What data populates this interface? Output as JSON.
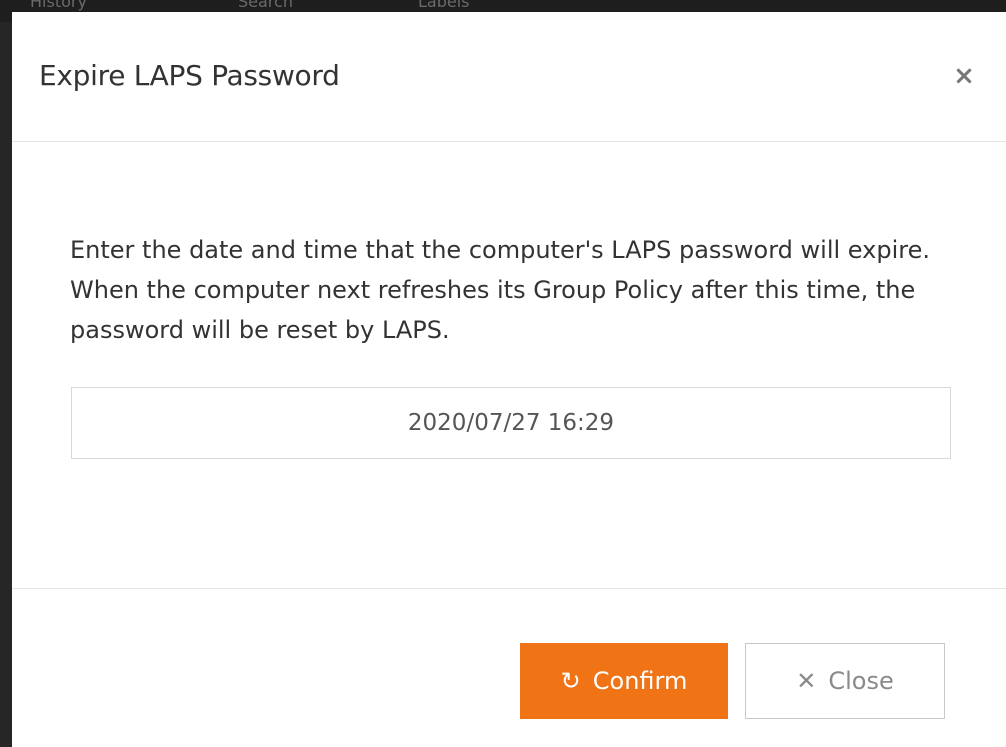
{
  "background": {
    "tabs": [
      "History",
      "Search",
      "Labels"
    ]
  },
  "dialog": {
    "title": "Expire LAPS Password",
    "close_icon": "×",
    "description": "Enter the date and time that the computer's LAPS password will expire. When the computer next refreshes its Group Policy after this time, the password will be reset by LAPS.",
    "expiry_value": "2020/07/27 16:29",
    "confirm_label": "Confirm",
    "confirm_icon": "refresh-icon",
    "confirm_glyph": "↻",
    "close_label": "Close",
    "close_button_icon": "close-icon",
    "close_button_glyph": "✕"
  },
  "colors": {
    "accent": "#f07315",
    "text": "#333333",
    "border": "#d8d8d8"
  }
}
